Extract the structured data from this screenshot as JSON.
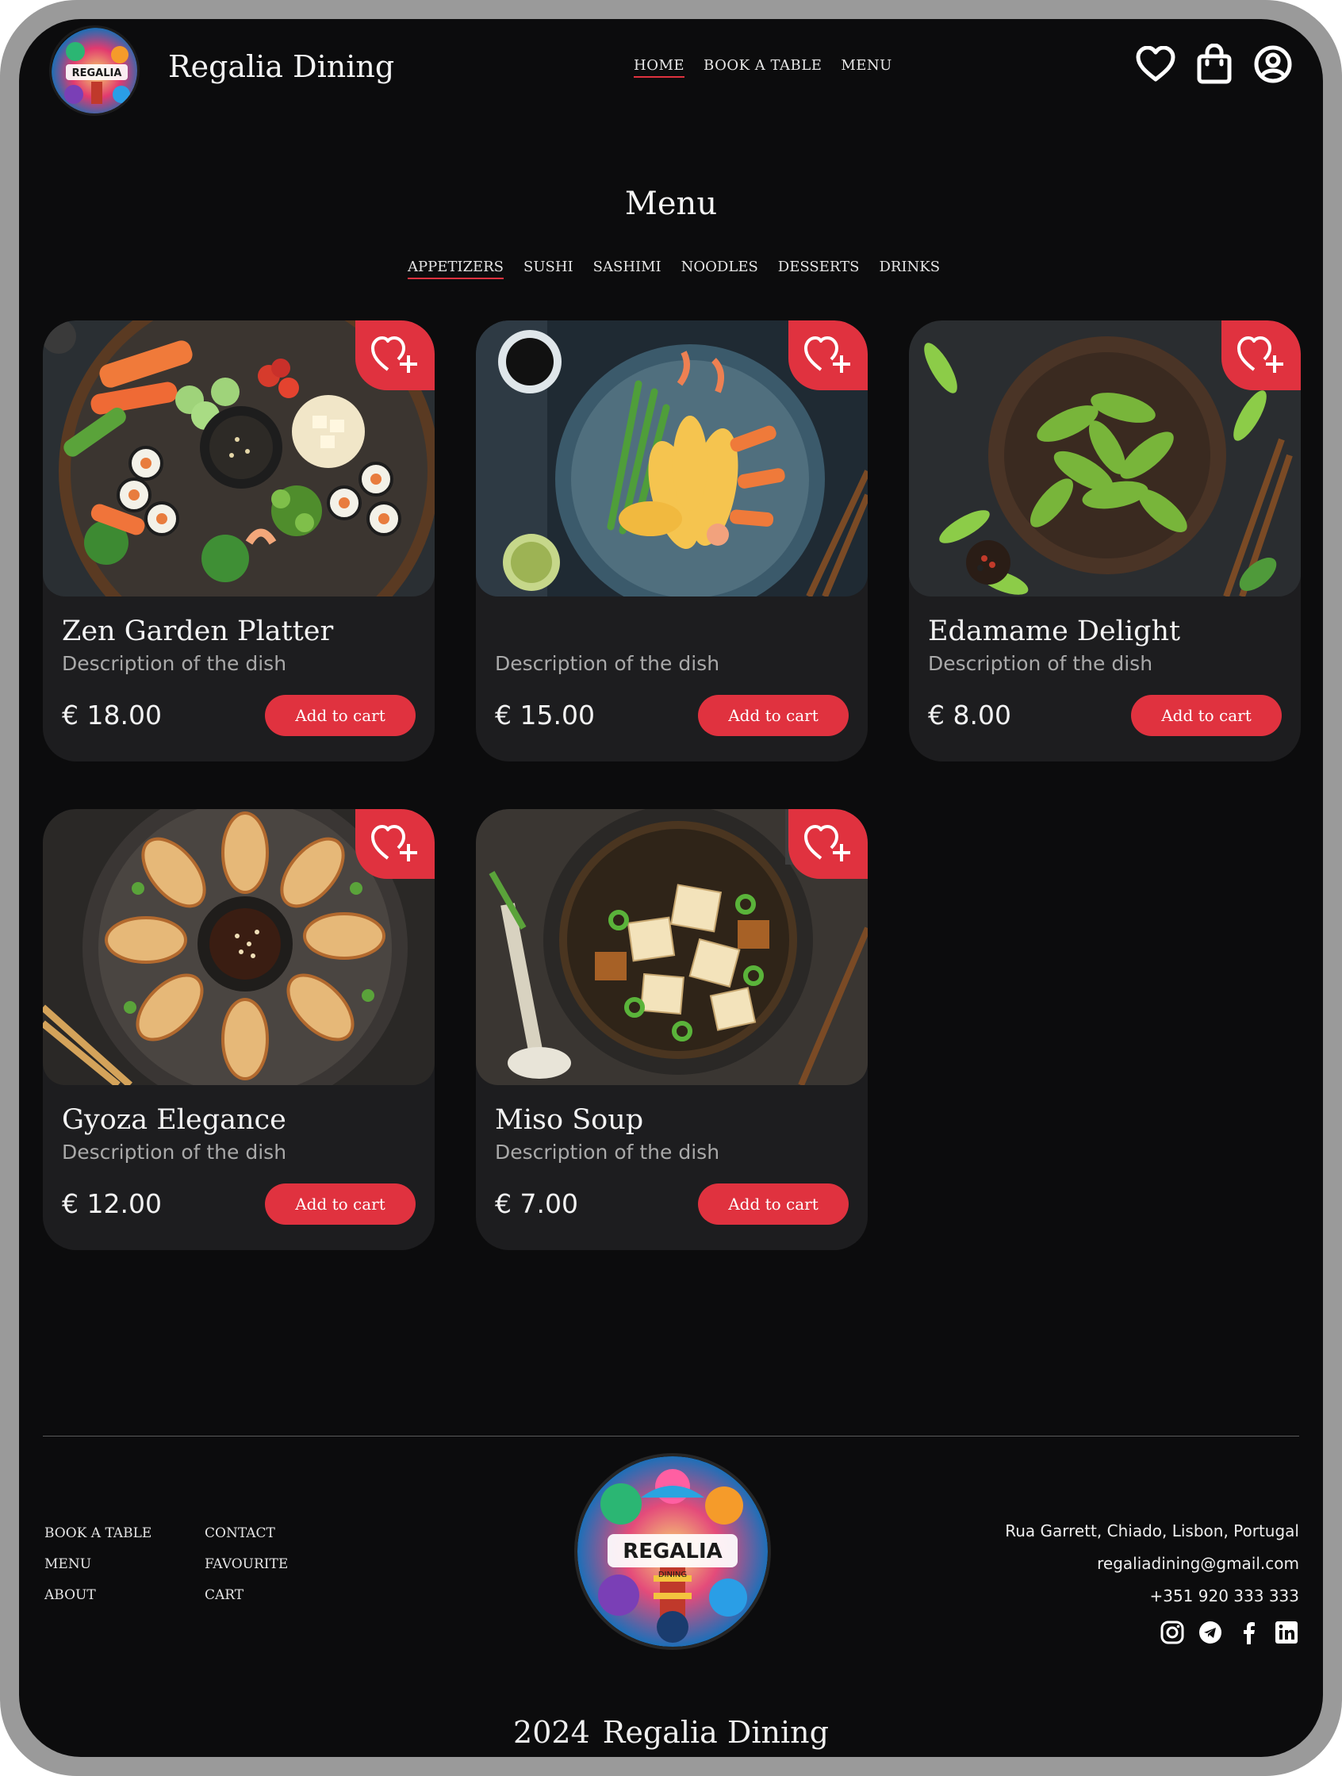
{
  "header": {
    "brand": "Regalia Dining",
    "logo_text": "REGALIA",
    "nav": [
      "HOME",
      "BOOK A TABLE",
      "MENU"
    ],
    "active_nav": "HOME",
    "icons": [
      "heart-icon",
      "shopping-bag-icon",
      "user-icon"
    ]
  },
  "menu": {
    "title": "Menu",
    "categories": [
      "APPETIZERS",
      "SUSHI",
      "SASHIMI",
      "NOODLES",
      "DESSERTS",
      "DRINKS"
    ],
    "active_category": "APPETIZERS"
  },
  "cards": [
    {
      "name": "Zen Garden Platter",
      "description": "Description of the dish",
      "price": "€ 18.00",
      "button": "Add to cart"
    },
    {
      "name": "",
      "description": "Description of the dish",
      "price": "€ 15.00",
      "button": "Add to cart"
    },
    {
      "name": "Edamame Delight",
      "description": "Description of the dish",
      "price": "€ 8.00",
      "button": "Add to cart"
    },
    {
      "name": "Gyoza Elegance",
      "description": "Description of the dish",
      "price": "€ 12.00",
      "button": "Add to cart"
    },
    {
      "name": "Miso Soup",
      "description": "Description of the dish",
      "price": "€ 7.00",
      "button": "Add to cart"
    }
  ],
  "footer": {
    "links_col1": [
      "BOOK A TABLE",
      "MENU",
      "ABOUT"
    ],
    "links_col2": [
      "CONTACT",
      "FAVOURITE",
      "CART"
    ],
    "logo_text": "REGALIA",
    "logo_subtext": "DINING",
    "address": "Rua Garrett, Chiado, Lisbon, Portugal",
    "email": "regaliadining@gmail.com",
    "phone": "+351 920 333 333",
    "socials": [
      "instagram-icon",
      "telegram-icon",
      "facebook-icon",
      "linkedin-icon"
    ],
    "copyright_year": "2024",
    "copyright_name": "Regalia Dining"
  },
  "colors": {
    "accent": "#e0323f",
    "background": "#0c0c0d",
    "card": "#1d1d1f",
    "frame": "#9a9a9a"
  }
}
